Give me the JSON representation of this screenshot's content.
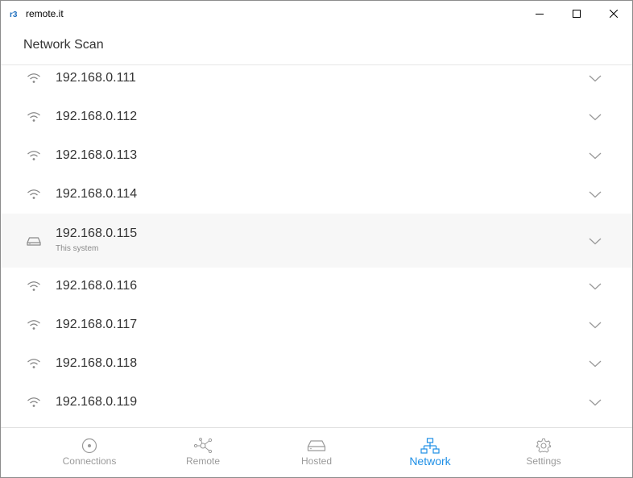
{
  "window": {
    "app_title": "remote.it",
    "controls": [
      "minimize",
      "maximize",
      "close"
    ]
  },
  "header": {
    "title": "Network Scan"
  },
  "scan_list": {
    "rows": [
      {
        "ip": "192.168.0.111",
        "subtitle": "",
        "icon": "wifi-icon"
      },
      {
        "ip": "192.168.0.112",
        "subtitle": "",
        "icon": "wifi-icon"
      },
      {
        "ip": "192.168.0.113",
        "subtitle": "",
        "icon": "wifi-icon"
      },
      {
        "ip": "192.168.0.114",
        "subtitle": "",
        "icon": "wifi-icon"
      },
      {
        "ip": "192.168.0.115",
        "subtitle": "This system",
        "icon": "device-icon"
      },
      {
        "ip": "192.168.0.116",
        "subtitle": "",
        "icon": "wifi-icon"
      },
      {
        "ip": "192.168.0.117",
        "subtitle": "",
        "icon": "wifi-icon"
      },
      {
        "ip": "192.168.0.118",
        "subtitle": "",
        "icon": "wifi-icon"
      },
      {
        "ip": "192.168.0.119",
        "subtitle": "",
        "icon": "wifi-icon"
      }
    ]
  },
  "bottom_nav": {
    "active": "Network",
    "items": [
      {
        "label": "Connections",
        "icon": "connections-icon"
      },
      {
        "label": "Remote",
        "icon": "remote-icon"
      },
      {
        "label": "Hosted",
        "icon": "hosted-icon"
      },
      {
        "label": "Network",
        "icon": "network-icon"
      },
      {
        "label": "Settings",
        "icon": "gear-icon"
      }
    ]
  },
  "colors": {
    "accent": "#1e8fe6",
    "inactive": "#9a9a9a",
    "highlight_row": "#f7f7f7"
  }
}
